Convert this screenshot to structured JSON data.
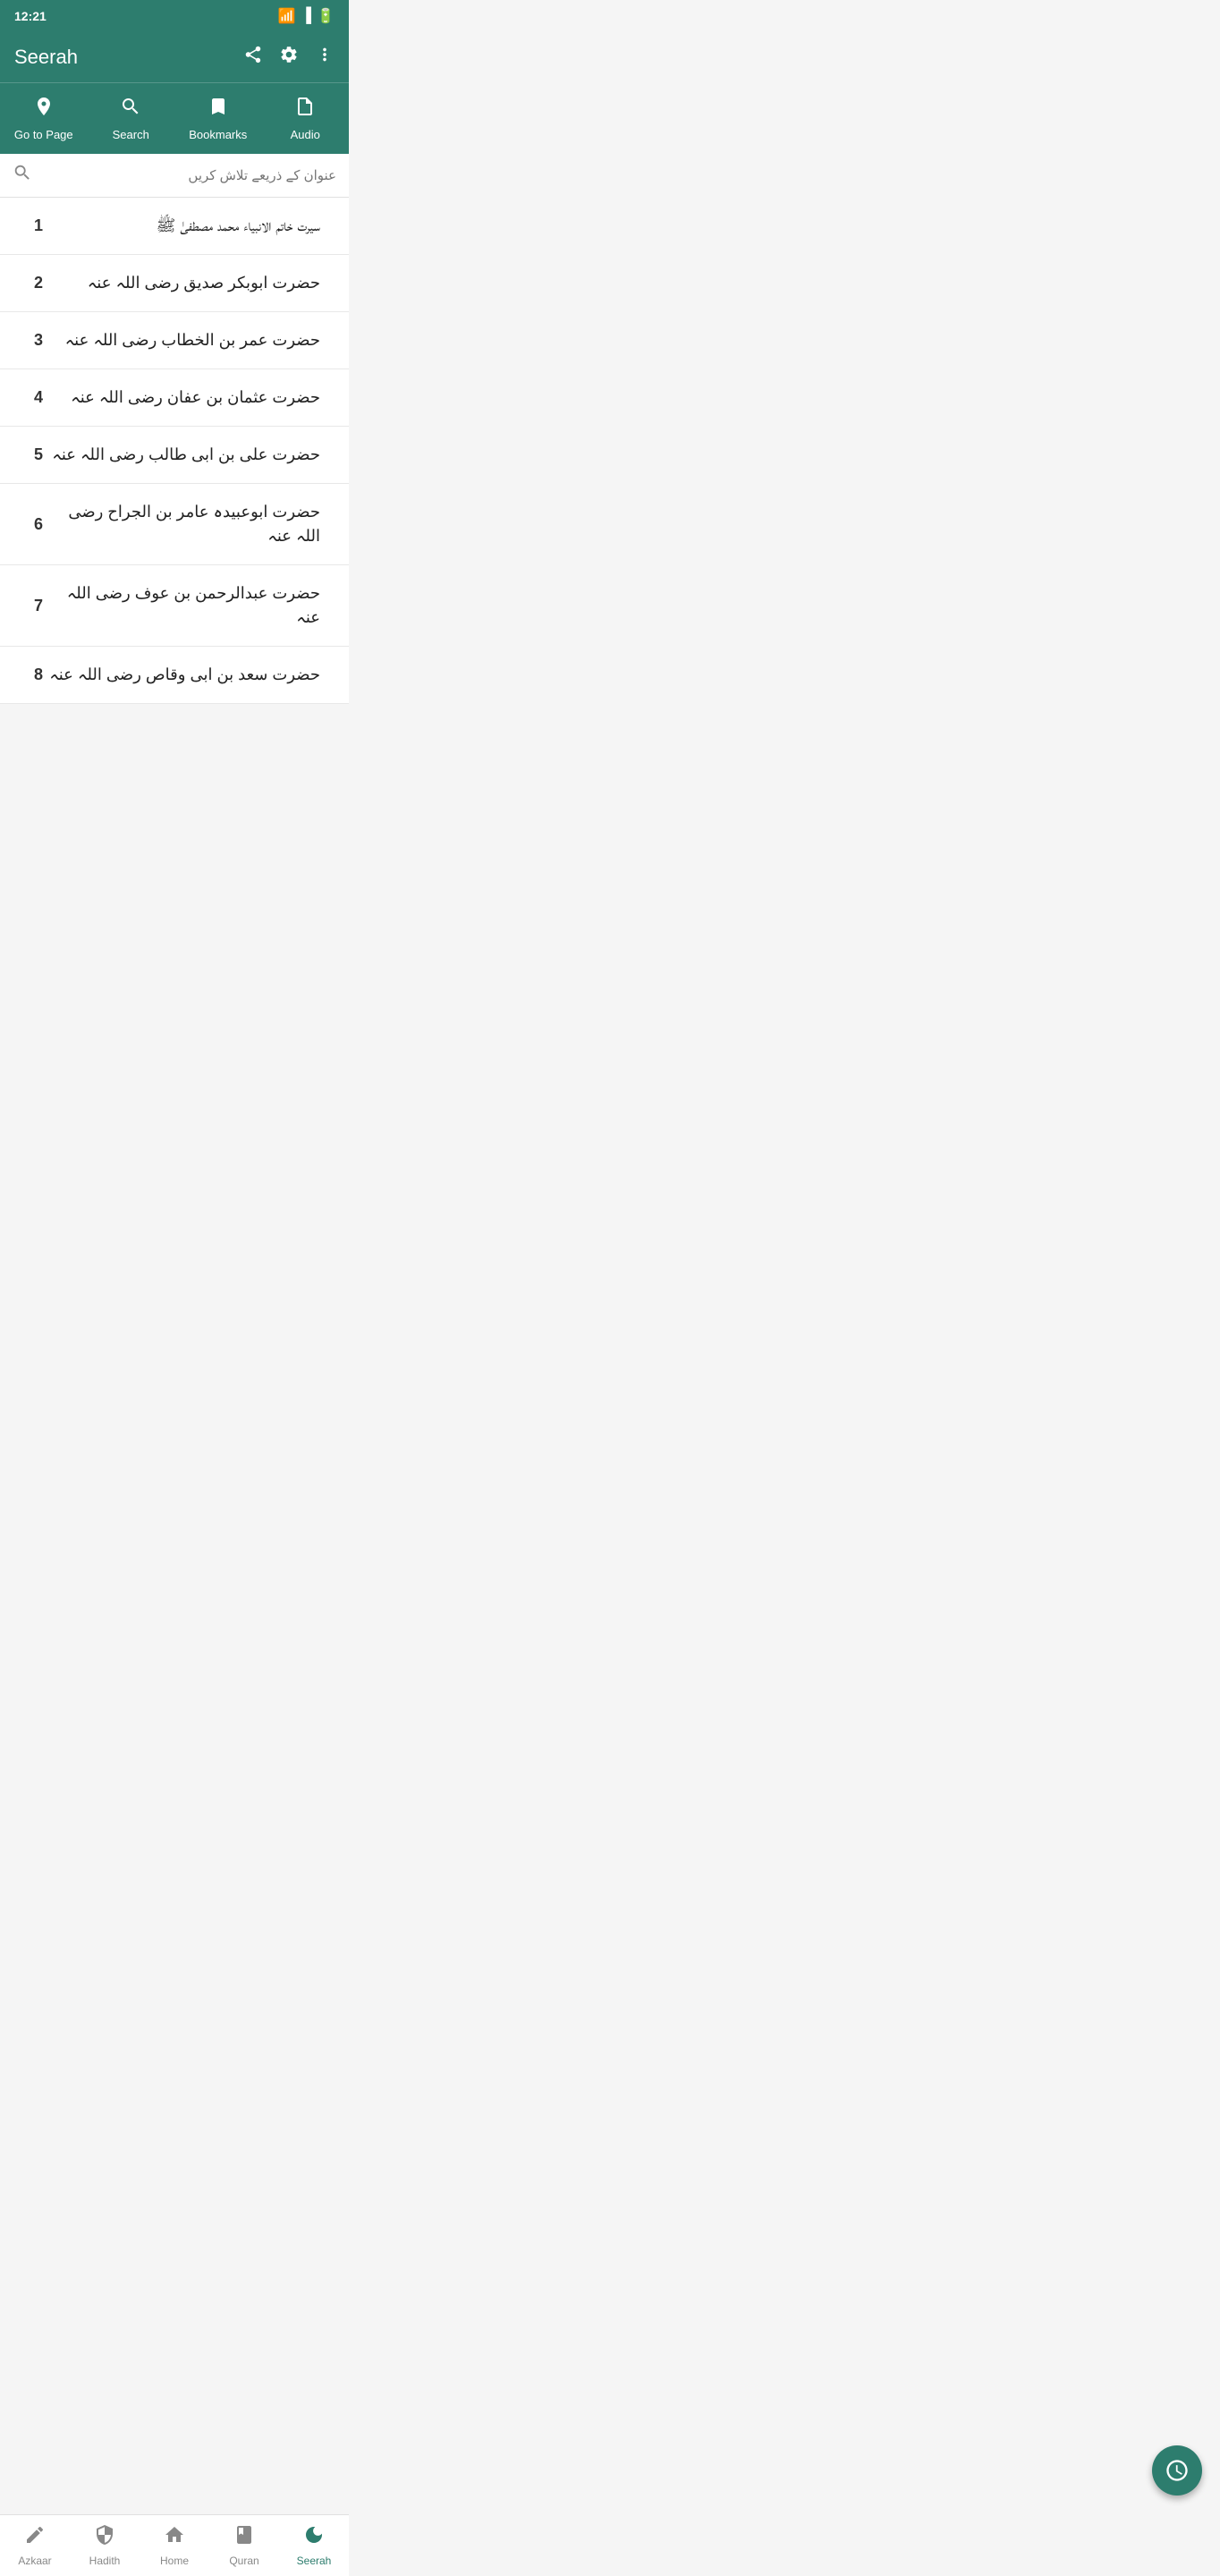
{
  "statusBar": {
    "time": "12:21"
  },
  "toolbar": {
    "title": "Seerah",
    "shareIcon": "⇧",
    "settingsIcon": "⚙",
    "moreIcon": "⋮"
  },
  "navTabs": [
    {
      "label": "Go to Page",
      "icon": "➤",
      "id": "goto"
    },
    {
      "label": "Search",
      "icon": "🔍",
      "id": "search"
    },
    {
      "label": "Bookmarks",
      "icon": "🔖",
      "id": "bookmarks"
    },
    {
      "label": "Audio",
      "icon": "📄",
      "id": "audio"
    }
  ],
  "searchBar": {
    "placeholder": "عنوان کے ذریعے تلاش کریں"
  },
  "chapters": [
    {
      "number": 1,
      "title": "سیرت خاتم الانبیاء محمد مصطفیٰ ﷺ"
    },
    {
      "number": 2,
      "title": "حضرت ابوبکر صدیق رضی اللہ عنہ"
    },
    {
      "number": 3,
      "title": "حضرت عمر بن الخطاب رضی اللہ عنہ"
    },
    {
      "number": 4,
      "title": "حضرت عثمان بن عفان رضی اللہ عنہ"
    },
    {
      "number": 5,
      "title": "حضرت علی بن ابی طالب رضی اللہ عنہ"
    },
    {
      "number": 6,
      "title": "حضرت ابوعبیدہ عامر بن الجراح رضی اللہ عنہ"
    },
    {
      "number": 7,
      "title": "حضرت عبدالرحمن بن عوف رضی اللہ عنہ"
    },
    {
      "number": 8,
      "title": "حضرت سعد بن ابی وقاص رضی اللہ عنہ"
    }
  ],
  "fab": {
    "icon": "🕐"
  },
  "bottomNav": [
    {
      "label": "Azkaar",
      "icon": "✏",
      "id": "azkaar",
      "active": false
    },
    {
      "label": "Hadith",
      "icon": "⚙",
      "id": "hadith",
      "active": false
    },
    {
      "label": "Home",
      "icon": "🏠",
      "id": "home",
      "active": false
    },
    {
      "label": "Quran",
      "icon": "📖",
      "id": "quran",
      "active": false
    },
    {
      "label": "Seerah",
      "icon": "☀",
      "id": "seerah",
      "active": true
    }
  ],
  "systemNav": {
    "back": "◀",
    "home": "●",
    "recents": "■"
  }
}
